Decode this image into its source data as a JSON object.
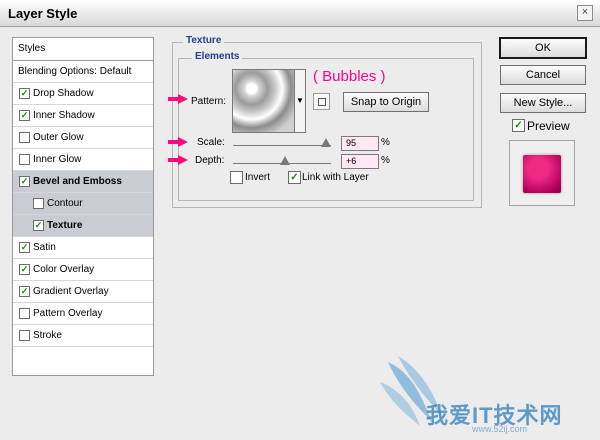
{
  "window": {
    "title": "Layer Style",
    "close_glyph": "×"
  },
  "styles_panel": {
    "header": "Styles",
    "blending_options": "Blending Options: Default",
    "items": [
      {
        "label": "Drop Shadow",
        "checked": true
      },
      {
        "label": "Inner Shadow",
        "checked": true
      },
      {
        "label": "Outer Glow",
        "checked": false
      },
      {
        "label": "Inner Glow",
        "checked": false
      },
      {
        "label": "Bevel and Emboss",
        "checked": true
      },
      {
        "label": "Contour",
        "checked": false
      },
      {
        "label": "Texture",
        "checked": true
      },
      {
        "label": "Satin",
        "checked": true
      },
      {
        "label": "Color Overlay",
        "checked": true
      },
      {
        "label": "Gradient Overlay",
        "checked": true
      },
      {
        "label": "Pattern Overlay",
        "checked": false
      },
      {
        "label": "Stroke",
        "checked": false
      }
    ]
  },
  "texture_panel": {
    "group_title": "Texture",
    "elements_title": "Elements",
    "pattern_label": "Pattern:",
    "pattern_annotation": "( Bubbles )",
    "snap_to_origin_label": "Snap to Origin",
    "scale_label": "Scale:",
    "scale_value": "95",
    "scale_fraction": 0.95,
    "depth_label": "Depth:",
    "depth_value": "+6",
    "depth_fraction": 0.53,
    "percent_sign": "%",
    "invert_label": "Invert",
    "invert_checked": false,
    "link_label": "Link with Layer",
    "link_checked": true
  },
  "buttons": {
    "ok": "OK",
    "cancel": "Cancel",
    "new_style": "New Style..."
  },
  "preview": {
    "label": "Preview",
    "checked": true,
    "swatch_color": "#d4006f"
  },
  "watermark": {
    "text": "我爱IT技术网",
    "url": "www.52ij.com"
  },
  "colors": {
    "accent": "#ff0a7b",
    "legend_blue": "#1f3f8f",
    "annotation_pink": "#ff0090"
  },
  "icons": {
    "arrow": "pink-arrow-icon",
    "dropdown": "chevron-down-icon",
    "snap": "snap-pattern-icon",
    "check": "check-icon"
  }
}
